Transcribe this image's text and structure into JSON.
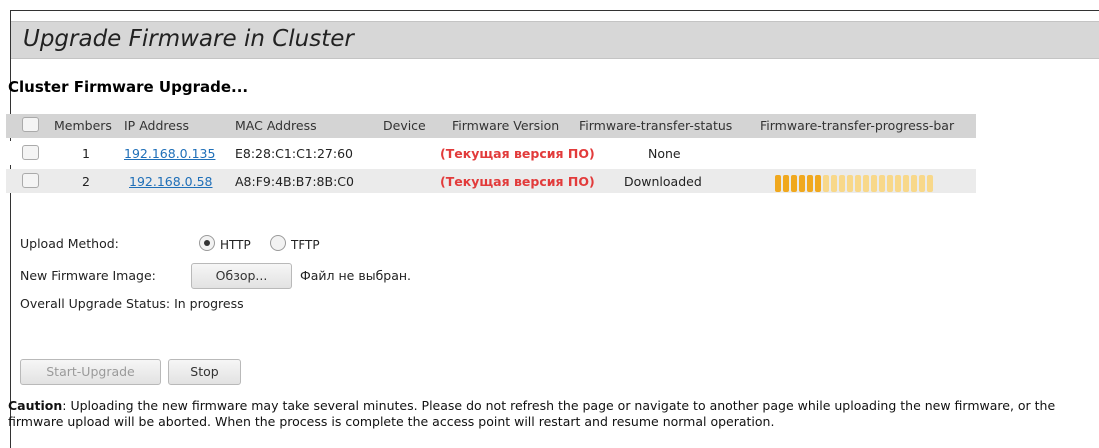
{
  "page": {
    "title": "Upgrade Firmware in Cluster",
    "section_title": "Cluster Firmware Upgrade..."
  },
  "table": {
    "columns": [
      "Members",
      "IP Address",
      "MAC Address",
      "Device",
      "Firmware Version",
      "Firmware-transfer-status",
      "Firmware-transfer-progress-bar"
    ],
    "rows": [
      {
        "member": "1",
        "ip": "192.168.0.135",
        "mac": "E8:28:C1:C1:27:60",
        "device": "",
        "firmware_version": "(Текущая версия ПО)",
        "status": "None",
        "progress_segments_filled": null
      },
      {
        "member": "2",
        "ip": "192.168.0.58",
        "mac": "A8:F9:4B:B7:8B:C0",
        "device": "",
        "firmware_version": "(Текущая версия ПО)",
        "status": "Downloaded",
        "progress_segments_filled": 6,
        "progress_segments_total": 20
      }
    ]
  },
  "form": {
    "upload_method_label": "Upload Method:",
    "upload_options": [
      "HTTP",
      "TFTP"
    ],
    "upload_selected": "HTTP",
    "new_image_label": "New Firmware Image:",
    "browse_button": "Обзор...",
    "file_status": "Файл не выбран.",
    "overall_status": "Overall Upgrade Status: In progress"
  },
  "buttons": {
    "start_upgrade": "Start-Upgrade",
    "stop": "Stop"
  },
  "caution": {
    "label": "Caution",
    "text": ": Uploading the new firmware may take several minutes. Please do not refresh the page or navigate to another page while uploading the new firmware, or the firmware upload will be aborted. When the process is complete the access point will restart and resume normal operation."
  },
  "colors": {
    "title_bar": "#d7d7d7",
    "link": "#1f6fb8",
    "firmware_red": "#e23b3b",
    "progress_filled": "#f0a81e",
    "progress_empty": "#f8d88a"
  }
}
